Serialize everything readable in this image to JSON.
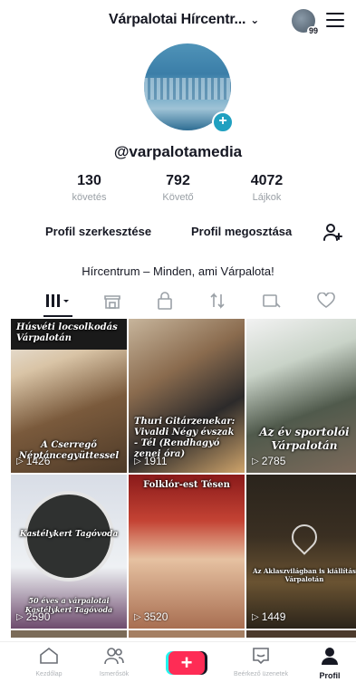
{
  "header": {
    "title": "Várpalotai Hírcentr...",
    "avatar_badge": "99"
  },
  "profile": {
    "username": "@varpalotamedia",
    "stats": [
      {
        "value": "130",
        "label": "követés"
      },
      {
        "value": "792",
        "label": "Követő"
      },
      {
        "value": "4072",
        "label": "Lájkok"
      }
    ],
    "edit_label": "Profil szerkesztése",
    "share_label": "Profil megosztása",
    "bio": "Hírcentrum – Minden, ami Várpalota!"
  },
  "tabs": [
    {
      "name": "videos",
      "icon": "grid-icon",
      "active": true
    },
    {
      "name": "shop",
      "icon": "shop-icon",
      "active": false
    },
    {
      "name": "private",
      "icon": "lock-icon",
      "active": false
    },
    {
      "name": "reposts",
      "icon": "repost-icon",
      "active": false
    },
    {
      "name": "favorites",
      "icon": "bookmark-icon",
      "active": false
    },
    {
      "name": "liked",
      "icon": "heart-icon",
      "active": false
    }
  ],
  "videos": [
    {
      "title_top": "Húsvéti locsolkodás Várpalotán",
      "caption": "A Cserregő Néptáncegyüttessel",
      "views": "1426"
    },
    {
      "caption": "Thuri Gitárzenekar: Vivaldi Négy évszak - Tél (Rendhagyó zenei óra)",
      "views": "1911"
    },
    {
      "caption": "Az év sportolói Várpalotán",
      "views": "2785"
    },
    {
      "title_top": "Kastélykert Tagóvoda",
      "caption": "50 éves a várpalotai Kastélykert Tagóvoda",
      "views": "2590"
    },
    {
      "title_top": "Folklór-est Tésen",
      "views": "3520"
    },
    {
      "caption": "Az Aklaszvilágban is kiállítás Várpalotán",
      "views": "1449"
    }
  ],
  "nav": {
    "home": "Kezdőlap",
    "friends": "Ismerősök",
    "inbox": "Beérkező üzenetek",
    "profile": "Profil",
    "create": "+"
  },
  "colors": {
    "accent": "#fe2c55",
    "cyan": "#25f4ee",
    "avatar_plus": "#20a0c0"
  }
}
